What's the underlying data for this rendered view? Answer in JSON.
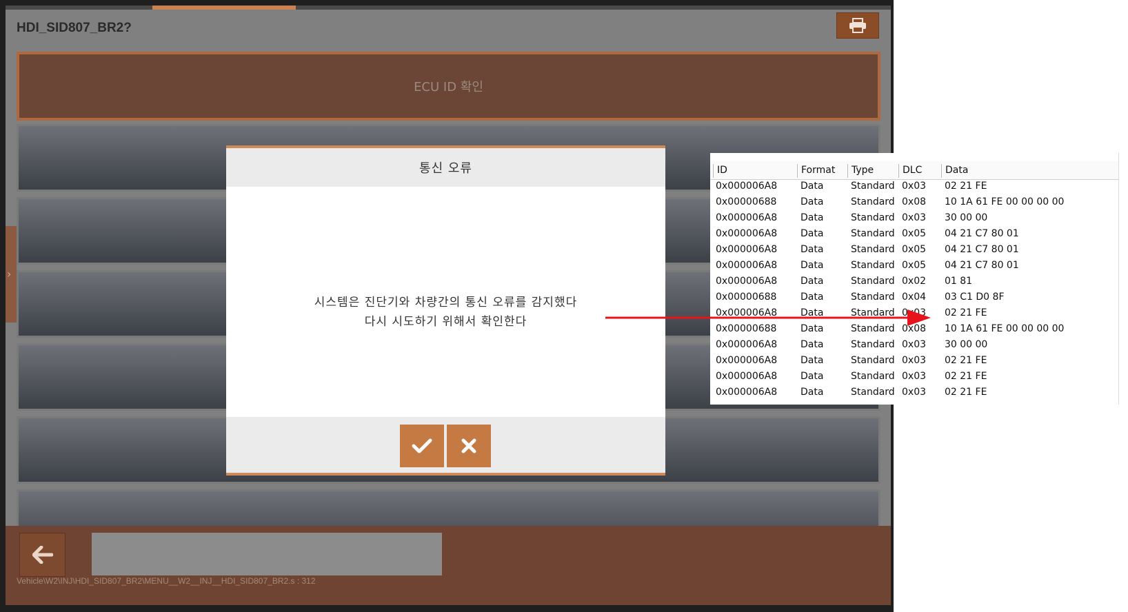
{
  "app": {
    "title": "HDI_SID807_BR2?",
    "ecu_button": "ECU ID 확인",
    "path": "Vehicle\\W2\\INJ\\HDI_SID807_BR2\\MENU__W2__INJ__HDI_SID807_BR2.s : 312",
    "icons": {
      "print": "printer-icon",
      "back": "arrow-left-icon",
      "side": "chevron-right-icon"
    }
  },
  "dialog": {
    "title": "통신 오류",
    "message_line1": "시스템은 진단기와 차량간의 통신 오류를 감지했다",
    "message_line2": "다시 시도하기 위해서 확인한다",
    "ok_icon": "check-icon",
    "cancel_icon": "close-icon"
  },
  "trace": {
    "columns": [
      "ID",
      "Format",
      "Type",
      "DLC",
      "Data"
    ],
    "rows": [
      [
        "0x000006A8",
        "Data",
        "Standard",
        "0x03",
        "02 21 FE"
      ],
      [
        "0x00000688",
        "Data",
        "Standard",
        "0x08",
        "10 1A 61 FE 00 00 00 00"
      ],
      [
        "0x000006A8",
        "Data",
        "Standard",
        "0x03",
        "30 00 00"
      ],
      [
        "0x000006A8",
        "Data",
        "Standard",
        "0x05",
        "04 21 C7 80 01"
      ],
      [
        "0x000006A8",
        "Data",
        "Standard",
        "0x05",
        "04 21 C7 80 01"
      ],
      [
        "0x000006A8",
        "Data",
        "Standard",
        "0x05",
        "04 21 C7 80 01"
      ],
      [
        "0x000006A8",
        "Data",
        "Standard",
        "0x02",
        "01 81"
      ],
      [
        "0x00000688",
        "Data",
        "Standard",
        "0x04",
        "03 C1 D0 8F"
      ],
      [
        "0x000006A8",
        "Data",
        "Standard",
        "0x03",
        "02 21 FE"
      ],
      [
        "0x00000688",
        "Data",
        "Standard",
        "0x08",
        "10 1A 61 FE 00 00 00 00"
      ],
      [
        "0x000006A8",
        "Data",
        "Standard",
        "0x03",
        "30 00 00"
      ],
      [
        "0x000006A8",
        "Data",
        "Standard",
        "0x03",
        "02 21 FE"
      ],
      [
        "0x000006A8",
        "Data",
        "Standard",
        "0x03",
        "02 21 FE"
      ],
      [
        "0x000006A8",
        "Data",
        "Standard",
        "0x03",
        "02 21 FE"
      ]
    ]
  },
  "colors": {
    "accent": "#c47a42",
    "arrow": "#e8141c",
    "bottom_bar": "#6f4433"
  }
}
